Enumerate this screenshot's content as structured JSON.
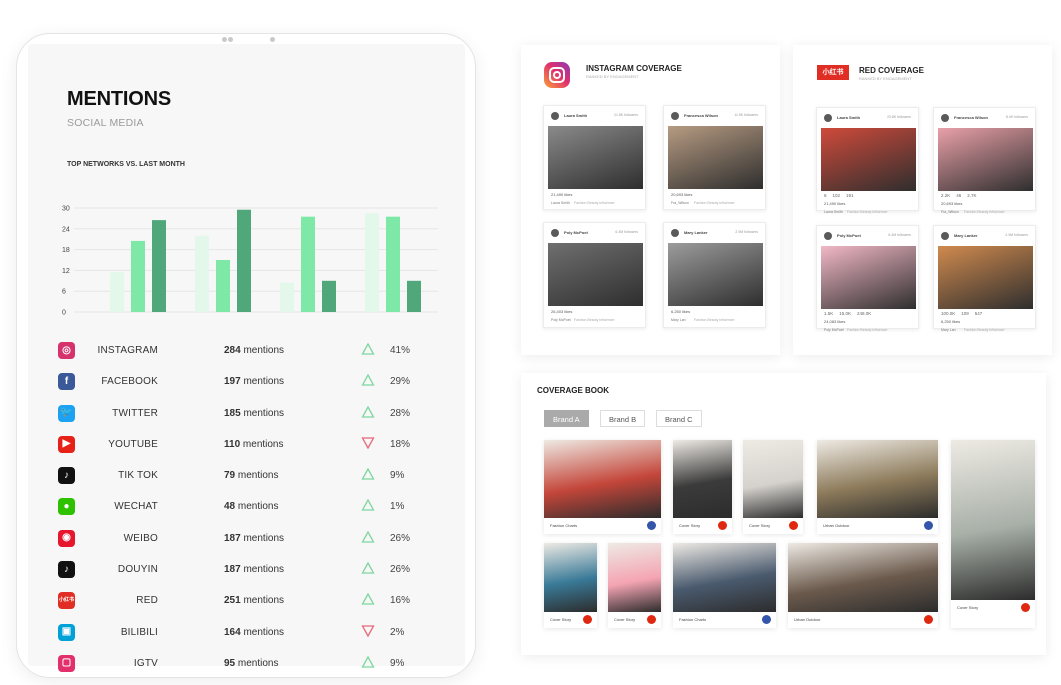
{
  "mentions": {
    "title": "MENTIONS",
    "subtitle": "SOCIAL MEDIA",
    "chart_label": "TOP NETWORKS VS. LAST MONTH",
    "networks": [
      {
        "name": "INSTAGRAM",
        "count": "284",
        "unit": "mentions",
        "trend": "up",
        "pct": "41%",
        "color": "#d6336c",
        "icon": "instagram-icon",
        "glyph": "◎"
      },
      {
        "name": "FACEBOOK",
        "count": "197",
        "unit": "mentions",
        "trend": "up",
        "pct": "29%",
        "color": "#3b5998",
        "icon": "facebook-icon",
        "glyph": "f"
      },
      {
        "name": "TWITTER",
        "count": "185",
        "unit": "mentions",
        "trend": "up",
        "pct": "28%",
        "color": "#1da1f2",
        "icon": "twitter-icon",
        "glyph": "🐦"
      },
      {
        "name": "YOUTUBE",
        "count": "110",
        "unit": "mentions",
        "trend": "down",
        "pct": "18%",
        "color": "#e62117",
        "icon": "youtube-icon",
        "glyph": "▶"
      },
      {
        "name": "TIK TOK",
        "count": "79",
        "unit": "mentions",
        "trend": "up",
        "pct": "9%",
        "color": "#111111",
        "icon": "tiktok-icon",
        "glyph": "♪"
      },
      {
        "name": "WECHAT",
        "count": "48",
        "unit": "mentions",
        "trend": "up",
        "pct": "1%",
        "color": "#2dc100",
        "icon": "wechat-icon",
        "glyph": "●"
      },
      {
        "name": "WEIBO",
        "count": "187",
        "unit": "mentions",
        "trend": "up",
        "pct": "26%",
        "color": "#e6162d",
        "icon": "weibo-icon",
        "glyph": "◉"
      },
      {
        "name": "DOUYIN",
        "count": "187",
        "unit": "mentions",
        "trend": "up",
        "pct": "26%",
        "color": "#111111",
        "icon": "douyin-icon",
        "glyph": "♪"
      },
      {
        "name": "RED",
        "count": "251",
        "unit": "mentions",
        "trend": "up",
        "pct": "16%",
        "color": "#e02e24",
        "icon": "red-icon",
        "glyph": "小红书"
      },
      {
        "name": "BILIBILI",
        "count": "164",
        "unit": "mentions",
        "trend": "down",
        "pct": "2%",
        "color": "#00a1d6",
        "icon": "bilibili-icon",
        "glyph": "▣"
      },
      {
        "name": "IGTV",
        "count": "95",
        "unit": "mentions",
        "trend": "up",
        "pct": "9%",
        "color": "#e1306c",
        "icon": "igtv-icon",
        "glyph": "▢"
      }
    ]
  },
  "chart_data": {
    "type": "bar",
    "title": "TOP NETWORKS VS. LAST MONTH",
    "ylim": [
      0,
      30
    ],
    "yticks": [
      "30",
      "24",
      "18",
      "12",
      "6",
      "0"
    ],
    "grid": true,
    "groups": [
      [
        {
          "value": 11.5,
          "shade": "light"
        },
        {
          "value": 20.5,
          "shade": "mid"
        },
        {
          "value": 26.5,
          "shade": "dark"
        }
      ],
      [
        {
          "value": 22,
          "shade": "light"
        },
        {
          "value": 15,
          "shade": "mid"
        },
        {
          "value": 29.5,
          "shade": "dark"
        }
      ],
      [
        {
          "value": 8.5,
          "shade": "light"
        },
        {
          "value": 27.5,
          "shade": "mid"
        },
        {
          "value": 9,
          "shade": "dark"
        }
      ],
      [
        {
          "value": 28.5,
          "shade": "light"
        },
        {
          "value": 27.5,
          "shade": "mid"
        },
        {
          "value": 9,
          "shade": "dark"
        }
      ]
    ],
    "colors": {
      "light": "#e3f7ea",
      "mid": "#7ee8a7",
      "dark": "#4fa77a"
    }
  },
  "instagram_coverage": {
    "title": "INSTAGRAM COVERAGE",
    "subtitle": "RANKED BY ENGAGEMENT",
    "posts": [
      {
        "user": "Laura Smith",
        "followers": "21.8K followers",
        "stat": "21,490 likes",
        "footer": "Laura Smith",
        "footer2": "Fashion Beauty Influencer",
        "photo": "#8a8a8a"
      },
      {
        "user": "Francesca Wilson",
        "followers": "11.5K followers",
        "stat": "20,693 likes",
        "footer": "Fra_Wilson",
        "footer2": "Fashion Beauty Influencer",
        "photo": "#b79b82"
      },
      {
        "user": "Poly McPoet",
        "followers": "6.4M followers",
        "stat": "26,403 likes",
        "footer": "Poly McPoet",
        "footer2": "Fashion Beauty Influencer",
        "photo": "#6f6f6f"
      },
      {
        "user": "Mary Lanker",
        "followers": "2.9M followers",
        "stat": "6,250 likes",
        "footer": "Mary Lan",
        "footer2": "Fashion Beauty Influencer",
        "photo": "#9c9c9c"
      }
    ]
  },
  "red_coverage": {
    "title": "RED COVERAGE",
    "subtitle": "RANKED BY ENGAGEMENT",
    "logo": "小红书",
    "posts": [
      {
        "user": "Laura Smith",
        "followers": "23.8K followers",
        "m1": "6",
        "m2": "102",
        "m3": "191",
        "stat": "21,490 likes",
        "footer": "Laura Smith",
        "footer2": "Fashion Beauty Influencer",
        "photo": "#cf4a3b"
      },
      {
        "user": "Francesca Wilson",
        "followers": "8.4K followers",
        "m1": "2.2K",
        "m2": "46",
        "m3": "2.7K",
        "stat": "20,693 likes",
        "footer": "Fra_Wilson",
        "footer2": "Fashion Beauty Influencer",
        "photo": "#e9a0a8"
      },
      {
        "user": "Poly McPoet",
        "followers": "6.4M followers",
        "m1": "1.5K",
        "m2": "15.0K",
        "m3": "248.0K",
        "stat": "24,083 likes",
        "footer": "Poly McPoet",
        "footer2": "Fashion Beauty Influencer",
        "photo": "#f2b8c6"
      },
      {
        "user": "Mary Lanker",
        "followers": "2.9M followers",
        "m1": "100.0K",
        "m2": "109",
        "m3": "547",
        "stat": "6,250 likes",
        "footer": "Mary Lan",
        "footer2": "Fashion Beauty Influencer",
        "photo": "#d08a4e"
      }
    ]
  },
  "coverage_book": {
    "title": "COVERAGE BOOK",
    "tabs": [
      "Brand A",
      "Brand B",
      "Brand C"
    ],
    "items": [
      {
        "caption": "Fashion Charts",
        "photo": "#c4463a",
        "flag": "#3355aa"
      },
      {
        "caption": "Cover Story",
        "photo": "#3b3b3b",
        "flag": "#de2910"
      },
      {
        "caption": "Cover Story",
        "photo": "#d5d2cd",
        "flag": "#de2910"
      },
      {
        "caption": "Urban Outdoor",
        "photo": "#8c7a5a",
        "flag": "#3355aa"
      },
      {
        "caption": "Cover Story",
        "photo": "#3a7a98",
        "flag": "#de2910"
      },
      {
        "caption": "Cover Story",
        "photo": "#f4a4b3",
        "flag": "#de2910"
      },
      {
        "caption": "Fashion Charts",
        "photo": "#4a5a6e",
        "flag": "#3355aa"
      },
      {
        "caption": "Urban Outdoor",
        "photo": "#6b5a4c",
        "flag": "#de2910"
      },
      {
        "caption": "Cover Story",
        "photo": "#a8b0a8",
        "flag": "#de2910"
      }
    ]
  }
}
